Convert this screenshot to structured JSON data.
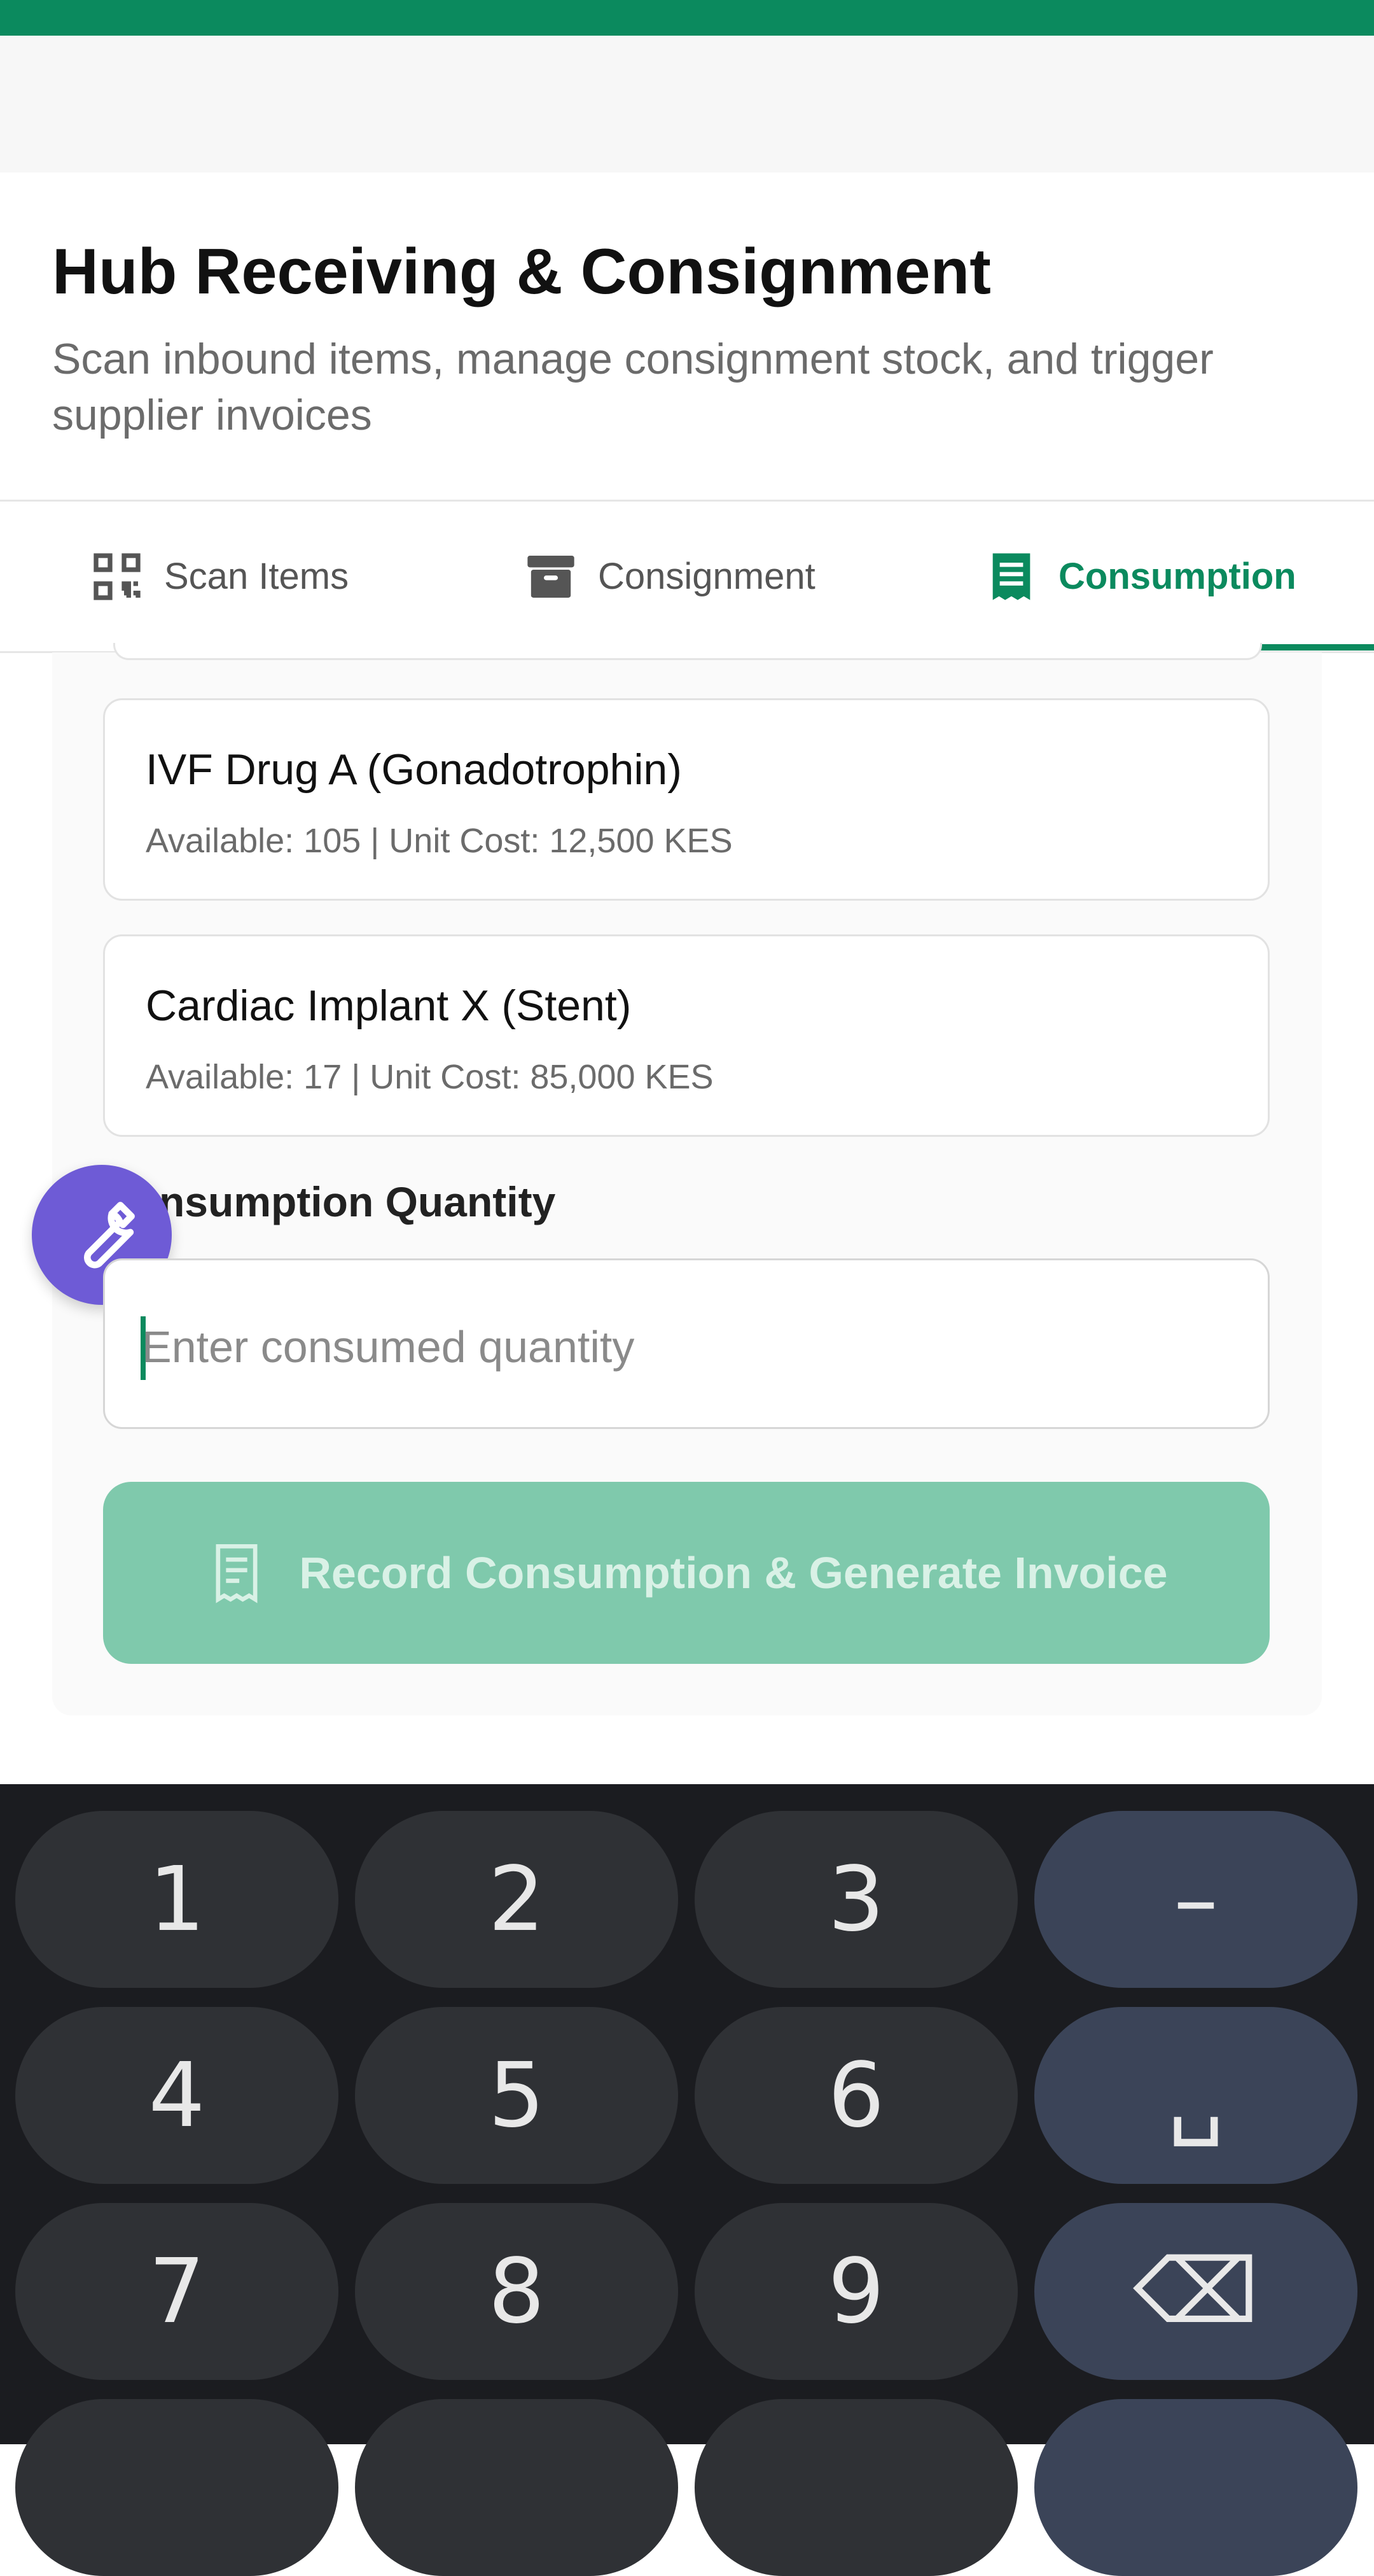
{
  "header": {
    "title": "Hub Receiving & Consignment",
    "subtitle": "Scan inbound items, manage consignment stock, and trigger supplier invoices"
  },
  "tabs": [
    {
      "label": "Scan Items",
      "icon": "qr-scan-icon",
      "active": false
    },
    {
      "label": "Consignment",
      "icon": "archive-box-icon",
      "active": false
    },
    {
      "label": "Consumption",
      "icon": "receipt-icon",
      "active": true
    }
  ],
  "items": [
    {
      "name": "IVF Drug A (Gonadotrophin)",
      "details": "Available: 105 | Unit Cost: 12,500 KES"
    },
    {
      "name": "Cardiac Implant X (Stent)",
      "details": "Available: 17 | Unit Cost: 85,000 KES"
    }
  ],
  "form": {
    "quantity_label": "Consumption Quantity",
    "quantity_placeholder": "Enter consumed quantity",
    "submit_label": "Record Consumption & Generate Invoice"
  },
  "keyboard": {
    "row1": [
      "1",
      "2",
      "3",
      "–"
    ],
    "row2": [
      "4",
      "5",
      "6",
      "␣"
    ],
    "row3": [
      "7",
      "8",
      "9",
      "⌫"
    ]
  },
  "colors": {
    "accent": "#0b8a5e",
    "button_disabled": "#7fc9ac",
    "fab": "#6e5bd6",
    "keyboard_bg": "#1b1c20"
  }
}
